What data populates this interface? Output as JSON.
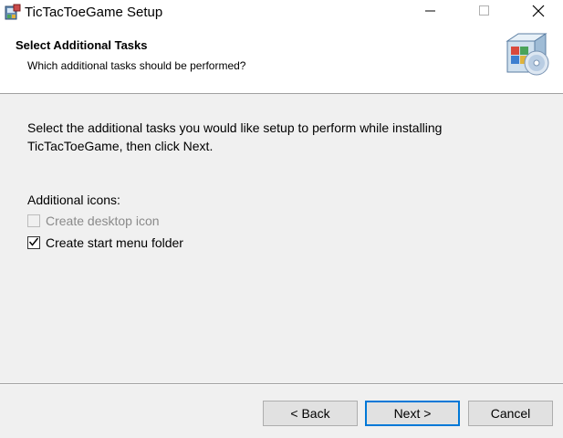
{
  "window": {
    "title": "TicTacToeGame Setup",
    "icons": {
      "app": "installer-icon",
      "minimize": "minimize-icon",
      "maximize": "maximize-icon",
      "close": "close-icon"
    }
  },
  "header": {
    "title": "Select Additional Tasks",
    "subtitle": "Which additional tasks should be performed?",
    "icon": "setup-box-icon"
  },
  "body": {
    "instruction": "Select the additional tasks you would like setup to perform while installing TicTacToeGame, then click Next.",
    "group_label": "Additional icons:",
    "tasks": [
      {
        "label": "Create desktop icon",
        "checked": false,
        "enabled": false
      },
      {
        "label": "Create start menu folder",
        "checked": true,
        "enabled": true
      }
    ]
  },
  "buttons": {
    "back": "< Back",
    "next": "Next >",
    "cancel": "Cancel"
  },
  "colors": {
    "background": "#f0f0f0",
    "header_background": "#ffffff",
    "focus_accent": "#0078d7",
    "disabled_text": "#8a8a8a"
  }
}
